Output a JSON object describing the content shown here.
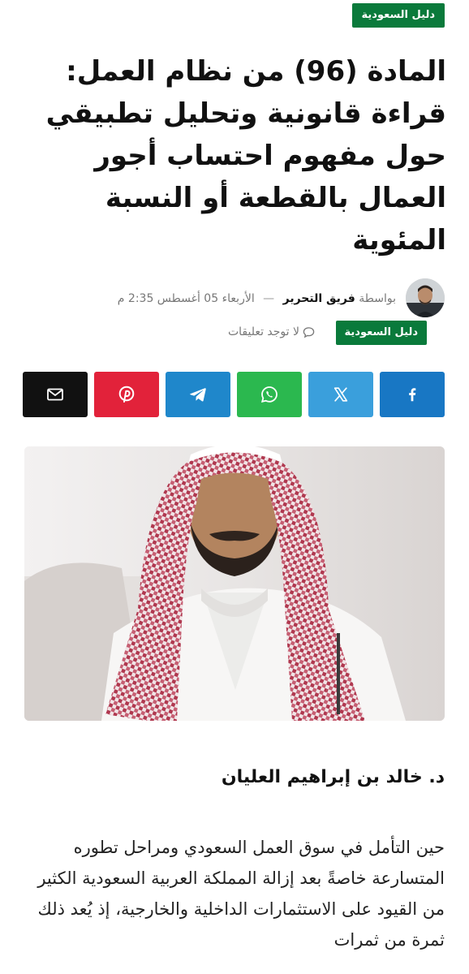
{
  "article": {
    "category_top": "دليل السعودية",
    "title": "المادة (96) من نظام العمل: قراءة قانونية وتحليل تطبيقي حول مفهوم احتساب أجور العمال بالقطعة أو النسبة المئوية",
    "meta": {
      "by_prefix": "بواسطة",
      "author": "فريق التحرير",
      "separator": "—",
      "date": "الأربعاء 05 أغسطس 2:35 م",
      "category": "دليل السعودية",
      "comments": "لا توجد تعليقات"
    },
    "share": [
      {
        "network": "facebook",
        "icon": "facebook-icon",
        "color": "#1877c4"
      },
      {
        "network": "x",
        "icon": "x-icon",
        "color": "#3a9fdc"
      },
      {
        "network": "whatsapp",
        "icon": "whatsapp-icon",
        "color": "#2bb84f"
      },
      {
        "network": "telegram",
        "icon": "telegram-icon",
        "color": "#1f87cb"
      },
      {
        "network": "pinterest",
        "icon": "pinterest-icon",
        "color": "#e2223a"
      },
      {
        "network": "email",
        "icon": "envelope-icon",
        "color": "#111111"
      }
    ],
    "image_description": "",
    "byline_author": "د. خالد بن إبراهيم العليان",
    "body": "حين التأمل في سوق العمل السعودي ومراحل تطوره المتسارعة خاصةً بعد إزالة المملكة العربية السعودية الكثير من القيود على الاستثمارات الداخلية والخارجية، إذ يُعد ذلك ثمرة من ثمرات"
  },
  "colors": {
    "category_badge": "#0a7a3b",
    "text": "#111111",
    "muted": "#777777"
  }
}
